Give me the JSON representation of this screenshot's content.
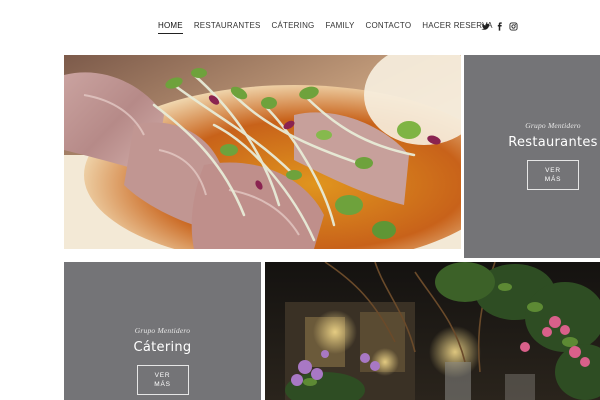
{
  "nav": {
    "items": [
      {
        "label": "HOME",
        "active": true
      },
      {
        "label": "RESTAURANTES",
        "active": false
      },
      {
        "label": "CÁTERING",
        "active": false
      },
      {
        "label": "FAMILY",
        "active": false
      },
      {
        "label": "CONTACTO",
        "active": false
      },
      {
        "label": "HACER RESERVA",
        "active": false
      }
    ]
  },
  "social": {
    "icons": [
      "twitter-icon",
      "facebook-icon",
      "instagram-icon"
    ]
  },
  "cards": {
    "restaurantes": {
      "eyebrow": "Grupo Mentidero",
      "title": "Restaurantes",
      "button_line1": "VER",
      "button_line2": "MÁS"
    },
    "catering": {
      "eyebrow": "Grupo Mentidero",
      "title": "Cátering",
      "button_line1": "VER",
      "button_line2": "MÁS"
    }
  },
  "colors": {
    "card_gray": "#747477",
    "text_dark": "#333333",
    "white": "#ffffff"
  }
}
